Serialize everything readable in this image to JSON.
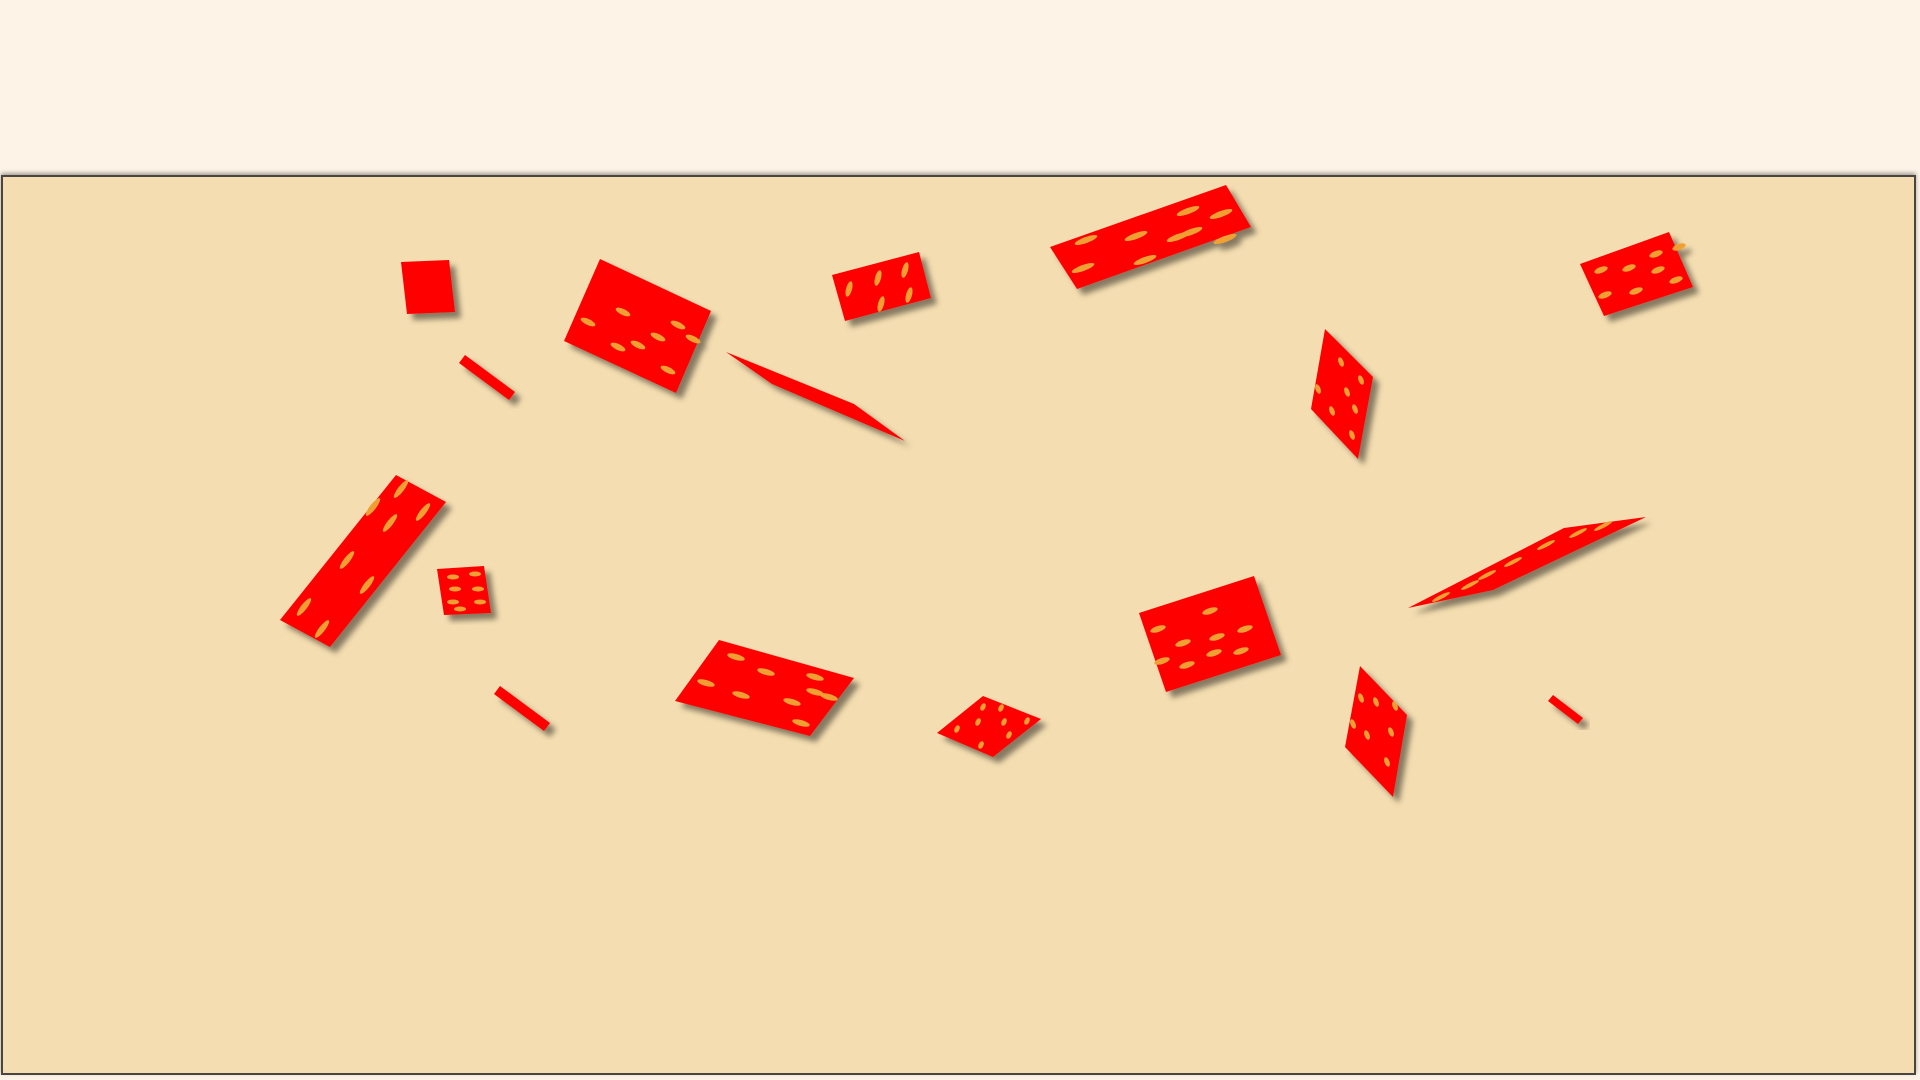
{
  "game": {
    "name": "confetti-pieces-board",
    "colors": {
      "background": "#fdf3e6",
      "board": "#f4ddb0",
      "board_border": "#4a4540",
      "piece_fill": "#ff0000",
      "piece_spots": "#f0a030",
      "shadow": "rgba(0,0,0,0.45)"
    },
    "piece_count": 18
  }
}
